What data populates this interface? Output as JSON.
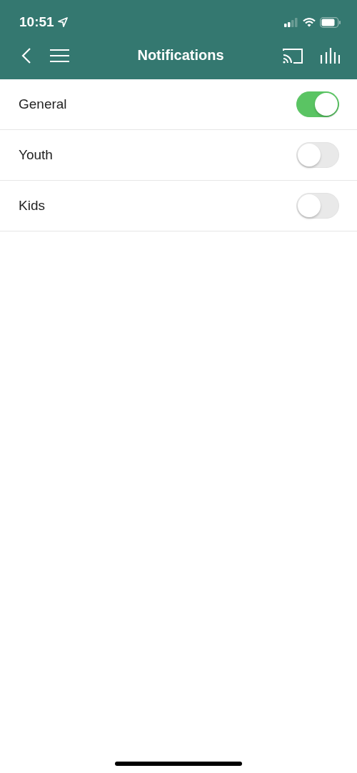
{
  "status_bar": {
    "time": "10:51"
  },
  "header": {
    "title": "Notifications"
  },
  "settings": [
    {
      "label": "General",
      "on": true
    },
    {
      "label": "Youth",
      "on": false
    },
    {
      "label": "Kids",
      "on": false
    }
  ]
}
